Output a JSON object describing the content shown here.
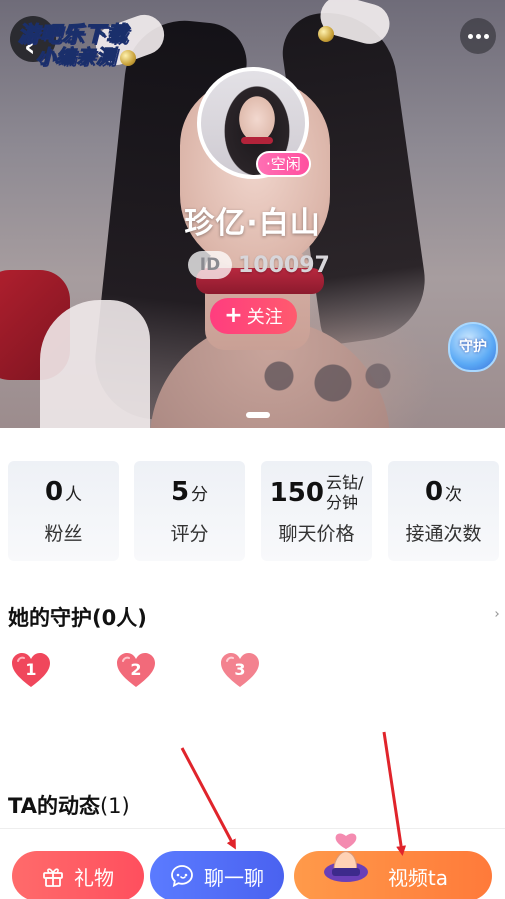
{
  "watermark": {
    "line1": "游吧乐下载",
    "line2": "小编亲测"
  },
  "profile": {
    "status": "·空闲",
    "name": "珍亿·白山",
    "id_label": "ID",
    "id_number": "100097",
    "follow_label": "关注",
    "guard_badge": "守护"
  },
  "stats": [
    {
      "value": "0",
      "unit": "人",
      "label": "粉丝"
    },
    {
      "value": "5",
      "unit": "分",
      "label": "评分"
    },
    {
      "value": "150",
      "unit_line1": "云钻/",
      "unit_line2": "分钟",
      "label": "聊天价格"
    },
    {
      "value": "0",
      "unit": "次",
      "label": "接通次数"
    }
  ],
  "guardians": {
    "title": "她的守护",
    "count": "(0人)",
    "slots": [
      "1",
      "2",
      "3"
    ]
  },
  "moments": {
    "title": "TA的动态",
    "count": "(1)"
  },
  "bottom": {
    "gift_label": "礼物",
    "chat_label": "聊一聊",
    "video_label": "视频ta"
  },
  "colors": {
    "follow": "#ff3d7f",
    "gift": "#ff5a64",
    "chat": "#5470f8",
    "video": "#ff8640",
    "status": "#ff5aa8",
    "heart": "#f0475c",
    "annotation_arrow": "#e0242b"
  },
  "icons": [
    "back-chevron-icon",
    "more-dots-icon",
    "plus-icon",
    "guard-shield-icon",
    "heart-icon",
    "gift-icon",
    "chat-bubble-icon"
  ]
}
